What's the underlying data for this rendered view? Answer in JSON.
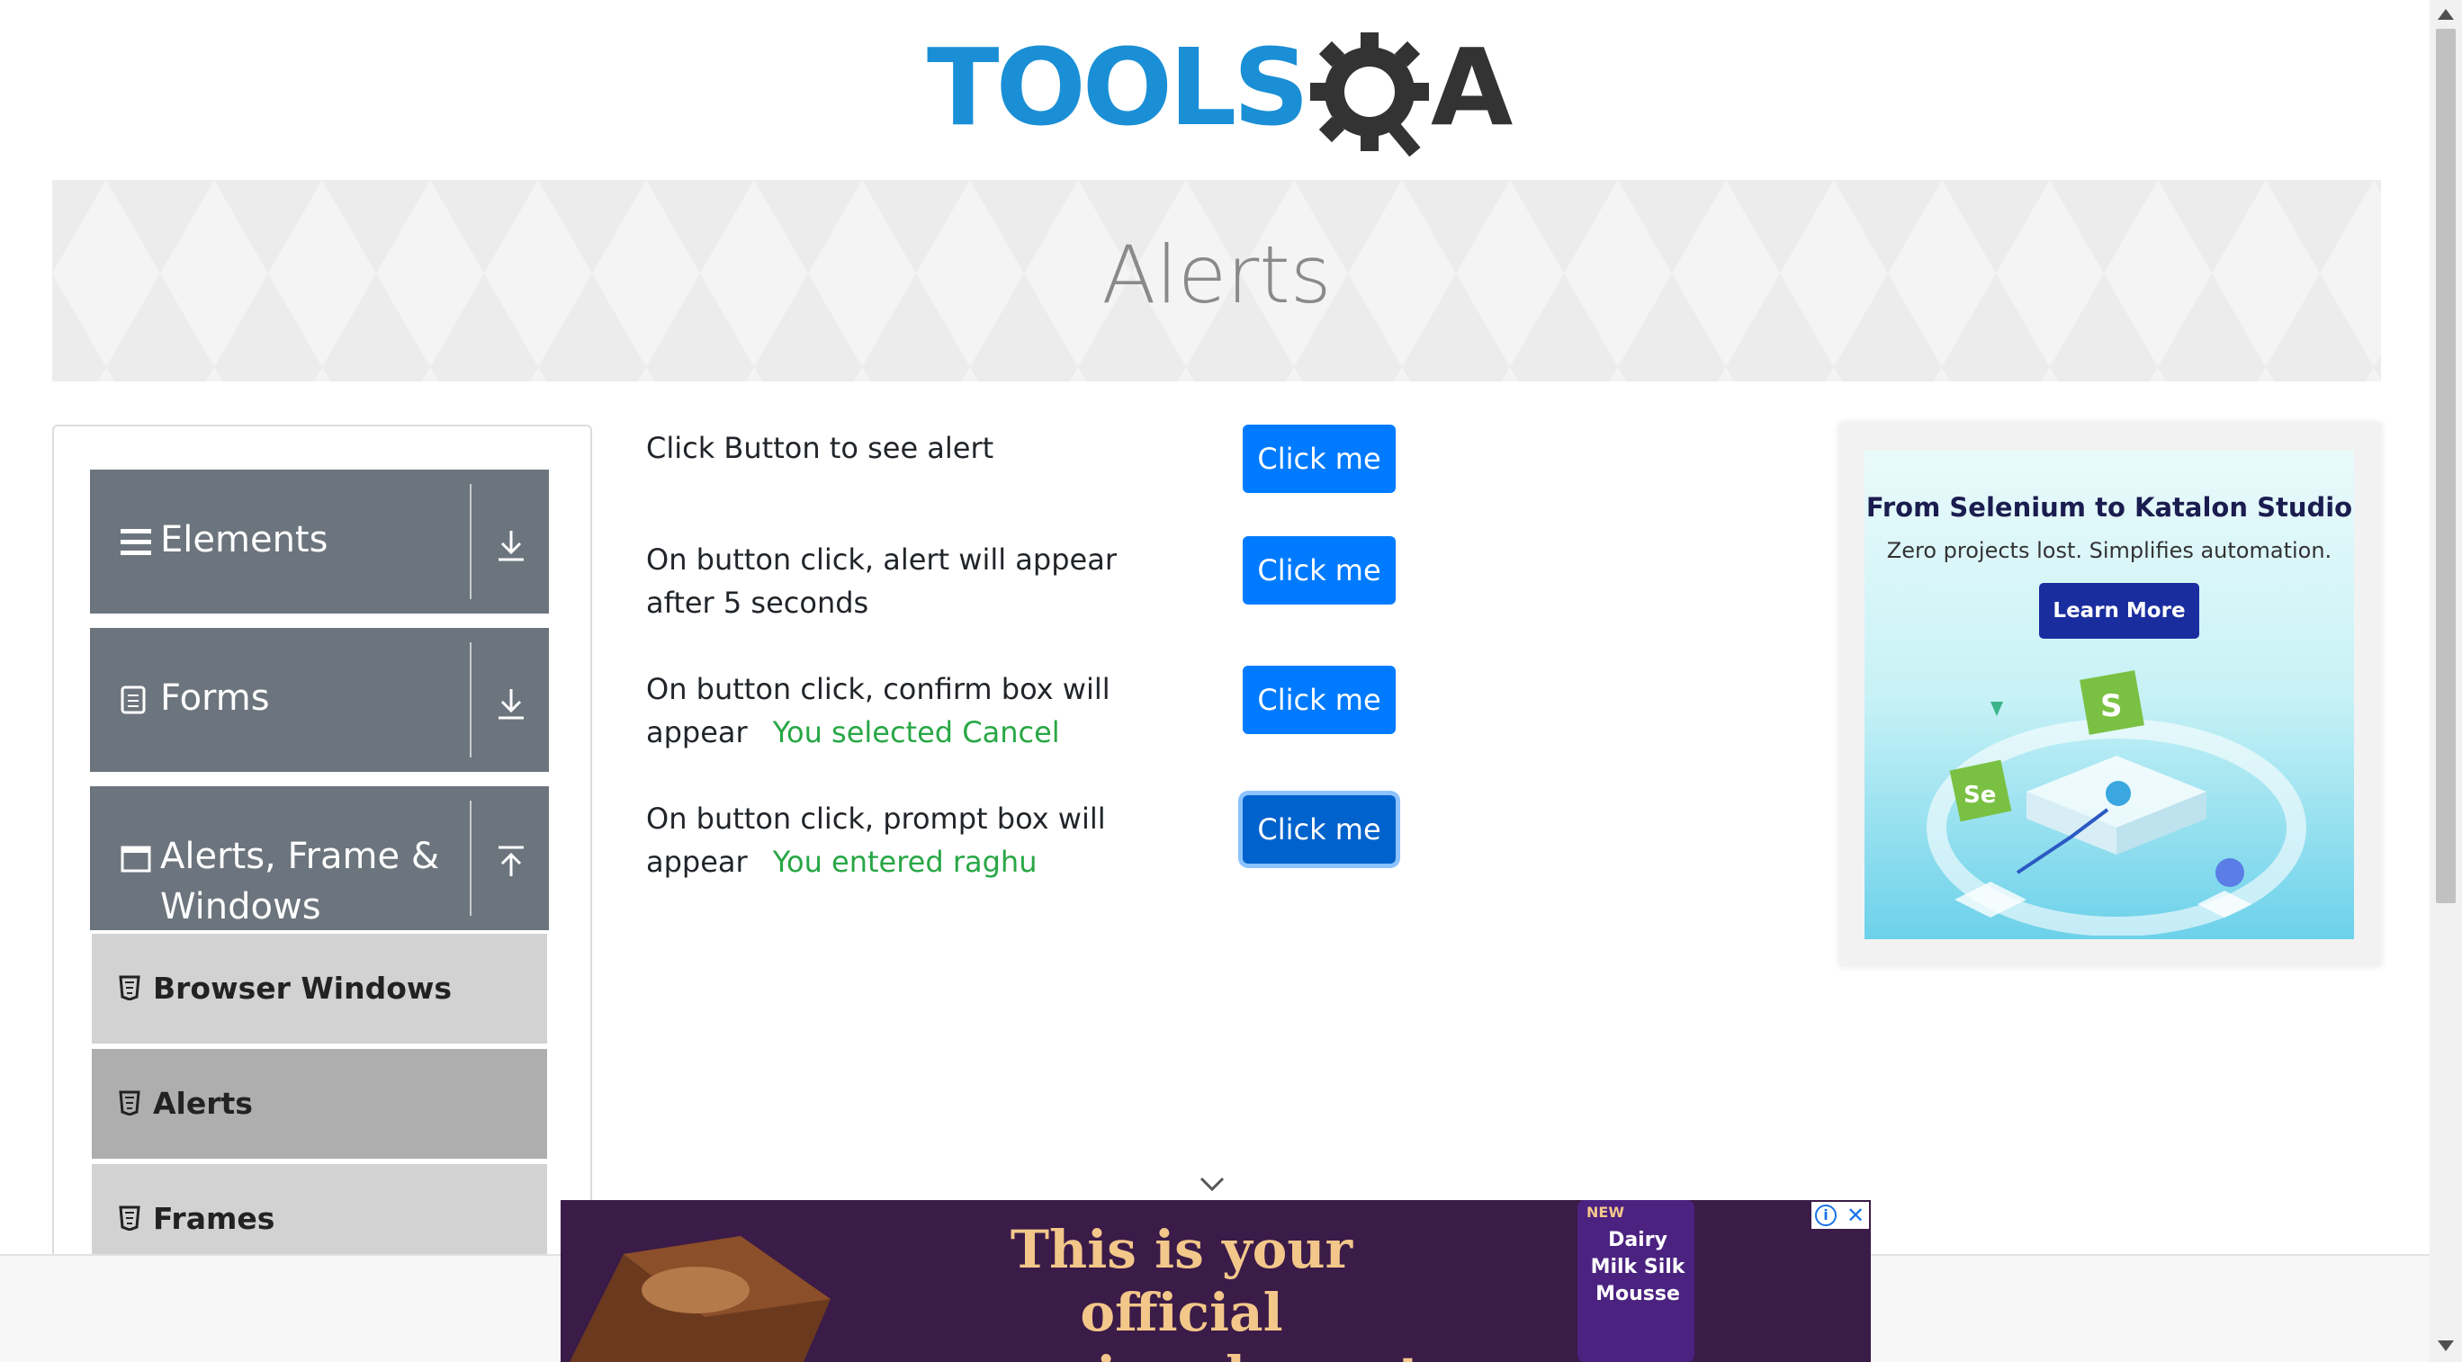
{
  "logo": {
    "text": "TOOLS",
    "text2": "A"
  },
  "page": {
    "title": "Alerts"
  },
  "sidebar": {
    "groups": [
      {
        "label": "Elements",
        "icon": "hamburger-icon",
        "arrow": "download-arrow-icon"
      },
      {
        "label": "Forms",
        "icon": "document-icon",
        "arrow": "download-arrow-icon"
      },
      {
        "label": "Alerts, Frame & Windows",
        "icon": "window-icon",
        "arrow": "upload-arrow-icon"
      }
    ],
    "items": [
      {
        "label": "Browser Windows",
        "active": false
      },
      {
        "label": "Alerts",
        "active": true
      },
      {
        "label": "Frames",
        "active": false
      }
    ]
  },
  "rows": [
    {
      "text": "Click Button to see alert",
      "result": "",
      "button": "Click me"
    },
    {
      "text": "On button click, alert will appear after 5 seconds",
      "result": "",
      "button": "Click me"
    },
    {
      "text": "On button click, confirm box will appear",
      "result": "You selected Cancel",
      "button": "Click me"
    },
    {
      "text": "On button click, prompt box will appear",
      "result": "You entered raghu",
      "button": "Click me"
    }
  ],
  "ad_right": {
    "title": "From Selenium to Katalon Studio",
    "subtitle": "Zero projects lost. Simplifies automation.",
    "button": "Learn More"
  },
  "ad_bottom": {
    "headline_line1": "This is your official",
    "headline_line2": "morning dessert",
    "pack_text": "Dairy Milk Silk Mousse",
    "pack_new": "NEW"
  },
  "colors": {
    "primary": "#007bff",
    "success": "#28a745",
    "sidebar_group": "#6c757d",
    "logo_blue": "#1a8fd6"
  }
}
